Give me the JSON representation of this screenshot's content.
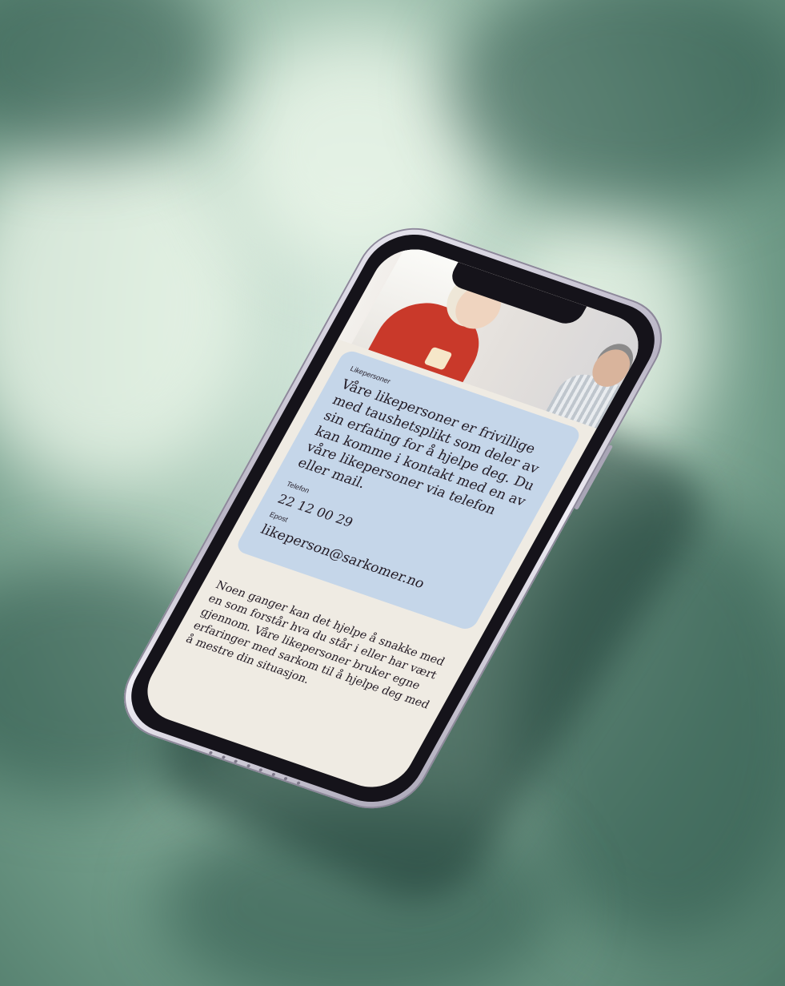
{
  "hero": {
    "image_alt": ""
  },
  "card": {
    "label": "Likepersoner",
    "title": "Våre likepersoner er frivillige med taushetsplikt som deler av sin erfating for å hjelpe deg. Du kan komme i kontakt med en av våre likepersoner via telefon eller mail.",
    "phone_label": "Telefon",
    "phone_value": "22 12 00 29",
    "email_label": "Epost",
    "email_value": "likeperson@sarkomer.no"
  },
  "body": {
    "text": "Noen ganger kan det hjelpe å snakke med en som forstår hva du står i eller har vært gjennom. Våre likepersoner bruker egne erfaringer med sarkom til å hjelpe deg med å mestre din situasjon."
  },
  "colors": {
    "card_background": "#c5d6e9",
    "screen_background": "#efebe3",
    "text": "#221a24"
  }
}
